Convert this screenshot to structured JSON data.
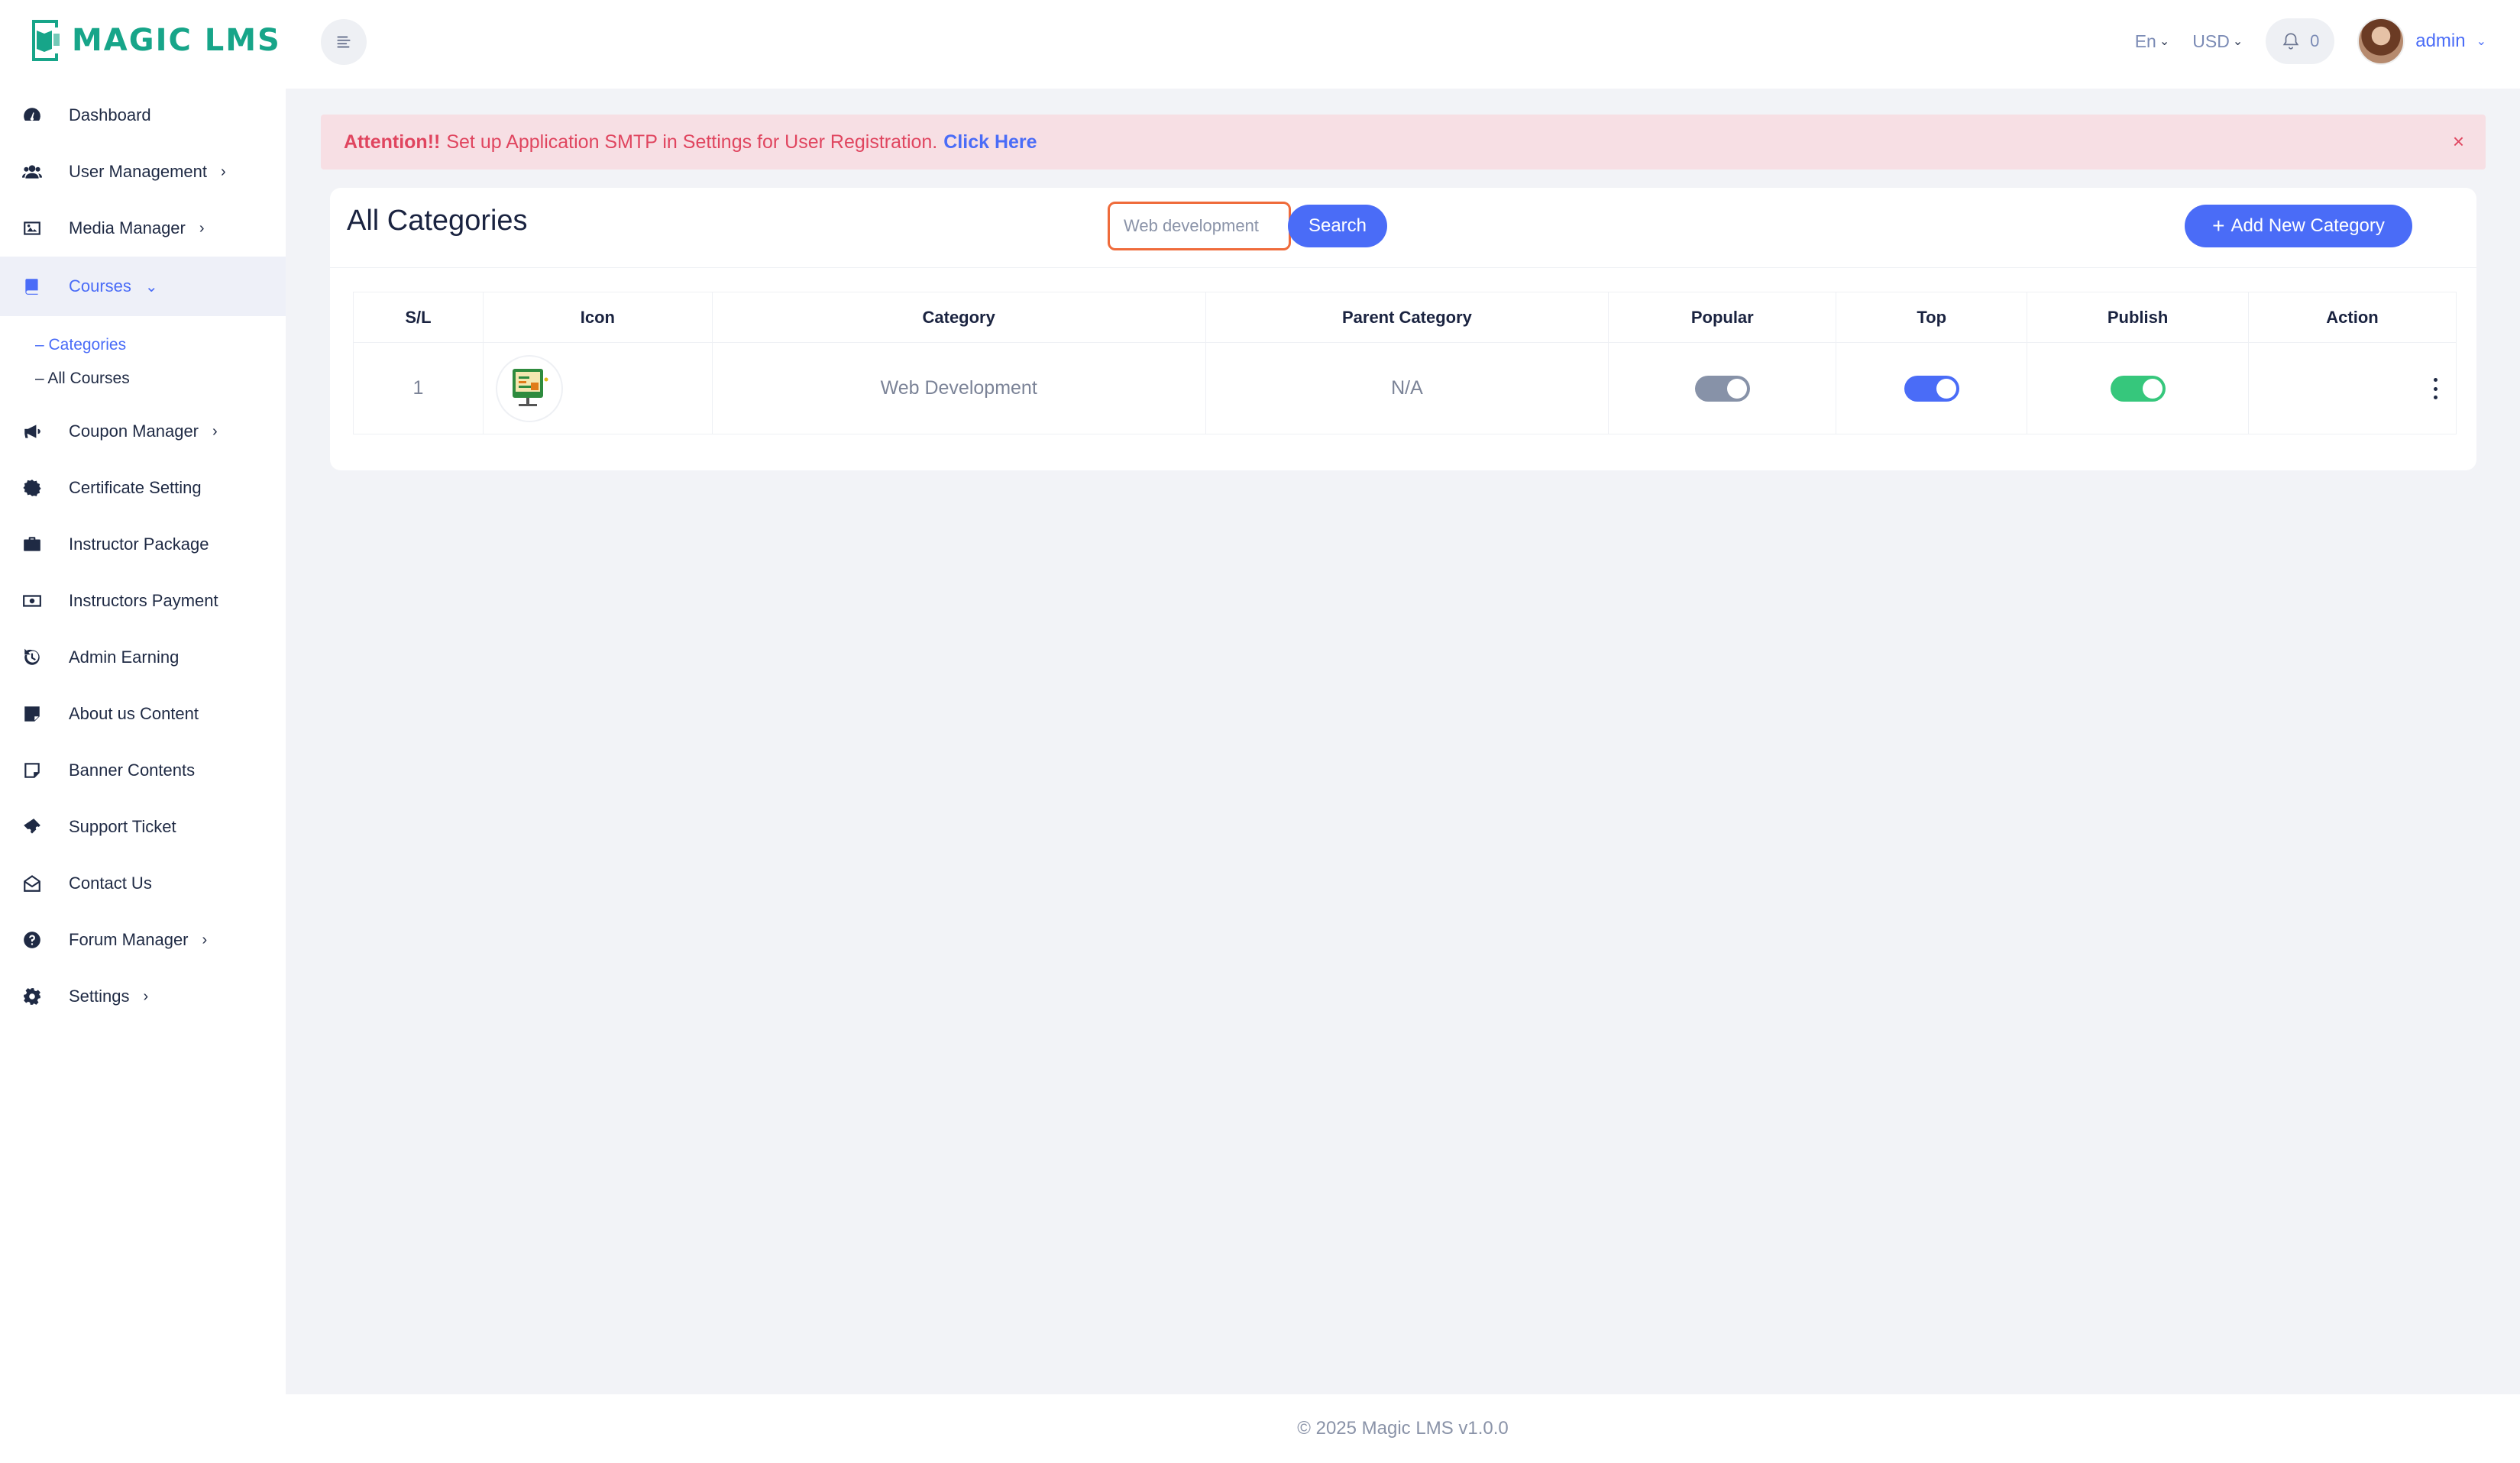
{
  "brand": {
    "name": "MAGIC LMS",
    "accent": "#17a589"
  },
  "sidebar": {
    "items": [
      {
        "label": "Dashboard",
        "icon": "dashboard-icon",
        "chevron": ""
      },
      {
        "label": "User Management",
        "icon": "users-icon",
        "chevron": "›"
      },
      {
        "label": "Media Manager",
        "icon": "image-icon",
        "chevron": "›"
      },
      {
        "label": "Courses",
        "icon": "book-icon",
        "chevron": "⌄"
      },
      {
        "label": "Coupon Manager",
        "icon": "megaphone-icon",
        "chevron": "›"
      },
      {
        "label": "Certificate Setting",
        "icon": "certificate-icon",
        "chevron": ""
      },
      {
        "label": "Instructor Package",
        "icon": "briefcase-icon",
        "chevron": ""
      },
      {
        "label": "Instructors Payment",
        "icon": "money-icon",
        "chevron": ""
      },
      {
        "label": "Admin Earning",
        "icon": "history-icon",
        "chevron": ""
      },
      {
        "label": "About us Content",
        "icon": "note-icon",
        "chevron": ""
      },
      {
        "label": "Banner Contents",
        "icon": "sticky-note-icon",
        "chevron": ""
      },
      {
        "label": "Support Ticket",
        "icon": "ticket-icon",
        "chevron": ""
      },
      {
        "label": "Contact Us",
        "icon": "envelope-open-icon",
        "chevron": ""
      },
      {
        "label": "Forum Manager",
        "icon": "question-icon",
        "chevron": "›"
      },
      {
        "label": "Settings",
        "icon": "gear-icon",
        "chevron": "›"
      }
    ],
    "courses_sub": [
      {
        "label": "– Categories"
      },
      {
        "label": "– All Courses"
      }
    ]
  },
  "topbar": {
    "language": "En",
    "currency": "USD",
    "notifications": "0",
    "user": "admin"
  },
  "alert": {
    "strong": "Attention!!",
    "text": "Set up Application SMTP in Settings for User Registration.",
    "link": "Click Here",
    "close": "×"
  },
  "page": {
    "title": "All Categories",
    "search_value": "Web development",
    "search_label": "Search",
    "add_label": "Add New Category"
  },
  "table": {
    "columns": [
      "S/L",
      "Icon",
      "Category",
      "Parent Category",
      "Popular",
      "Top",
      "Publish",
      "Action"
    ],
    "rows": [
      {
        "sl": "1",
        "icon": "monitor-code-icon",
        "category": "Web Development",
        "parent": "N/A",
        "popular": true,
        "top": true,
        "publish": true
      }
    ]
  },
  "footer": {
    "text": "© 2025 Magic LMS v1.0.0"
  }
}
